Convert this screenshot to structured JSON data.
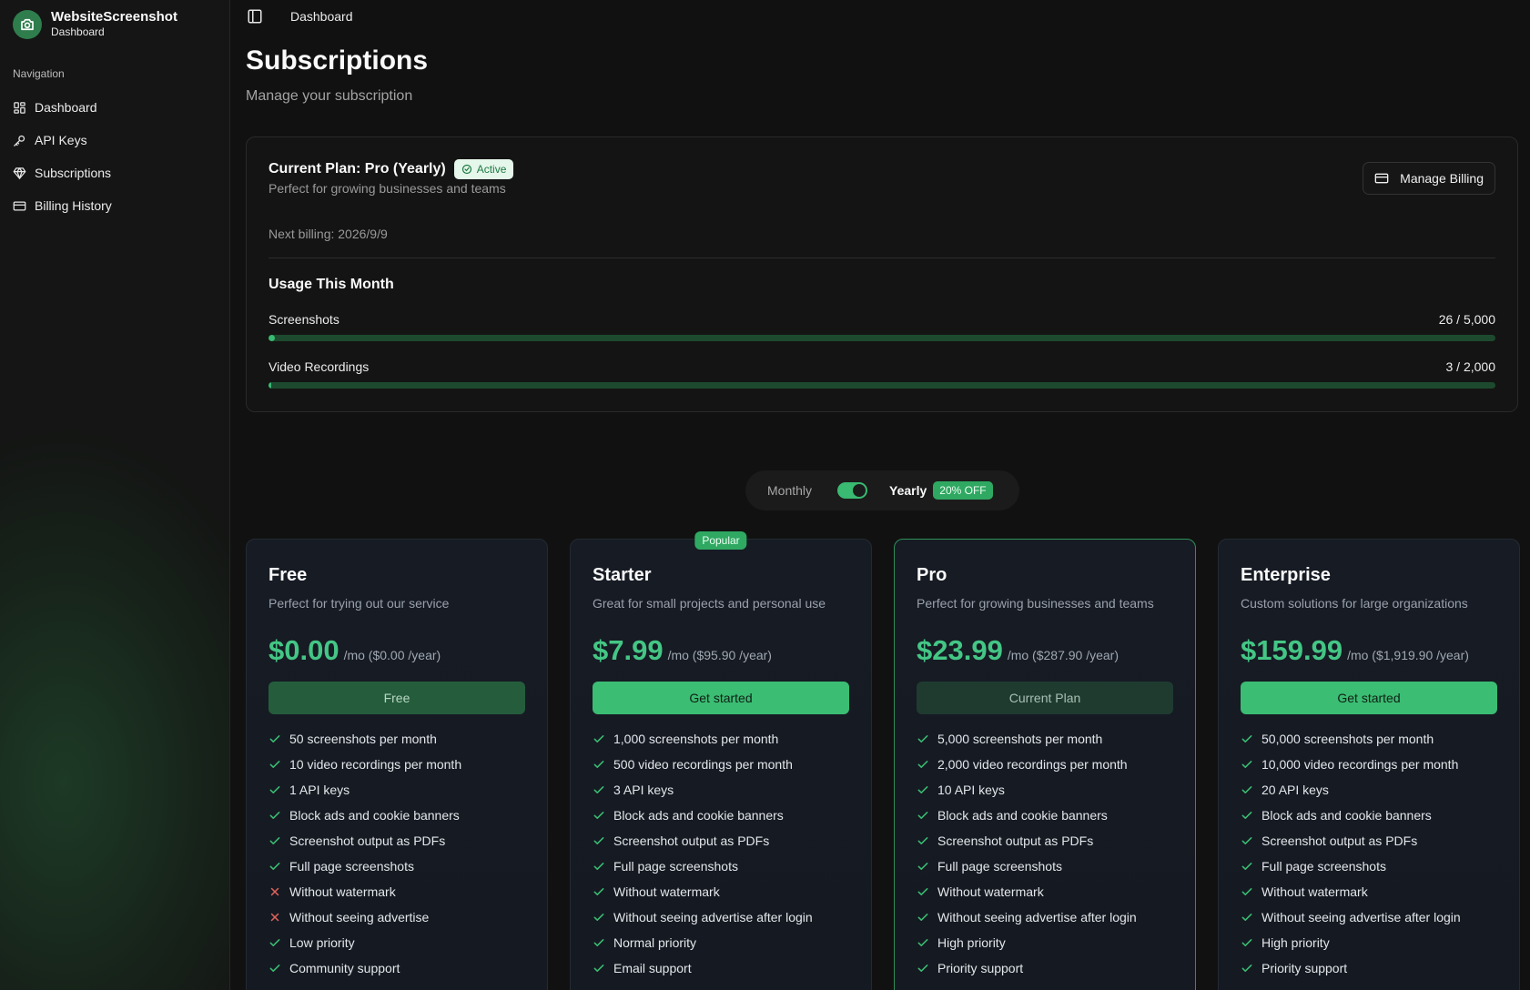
{
  "brand": {
    "title": "WebsiteScreenshot",
    "subtitle": "Dashboard"
  },
  "nav": {
    "heading": "Navigation",
    "items": [
      {
        "label": "Dashboard",
        "icon": "grid-icon"
      },
      {
        "label": "API Keys",
        "icon": "key-icon"
      },
      {
        "label": "Subscriptions",
        "icon": "gem-icon"
      },
      {
        "label": "Billing History",
        "icon": "credit-card-icon"
      }
    ]
  },
  "topbar": {
    "breadcrumb": "Dashboard"
  },
  "header": {
    "title": "Subscriptions",
    "subtitle": "Manage your subscription"
  },
  "current_plan": {
    "title": "Current Plan: Pro (Yearly)",
    "status": "Active",
    "description": "Perfect for growing businesses and teams",
    "manage_label": "Manage Billing",
    "next_billing": "Next billing: 2026/9/9",
    "usage_title": "Usage This Month",
    "usage": [
      {
        "label": "Screenshots",
        "count": "26 / 5,000",
        "used": 26,
        "limit": 5000
      },
      {
        "label": "Video Recordings",
        "count": "3 / 2,000",
        "used": 3,
        "limit": 2000
      }
    ]
  },
  "billing_toggle": {
    "monthly": "Monthly",
    "yearly": "Yearly",
    "discount": "20% OFF",
    "selected": "yearly"
  },
  "colors": {
    "accent": "#39b971",
    "price": "#44c685",
    "check": "#3bbd73",
    "cross": "#e0625a"
  },
  "plans": [
    {
      "name": "Free",
      "description": "Perfect for trying out our service",
      "price": "$0.00",
      "period": "/mo ($0.00 /year)",
      "button": "Free",
      "button_style": "free",
      "features": [
        {
          "text": "50 screenshots per month",
          "ok": true
        },
        {
          "text": "10 video recordings per month",
          "ok": true
        },
        {
          "text": "1 API keys",
          "ok": true
        },
        {
          "text": "Block ads and cookie banners",
          "ok": true
        },
        {
          "text": "Screenshot output as PDFs",
          "ok": true
        },
        {
          "text": "Full page screenshots",
          "ok": true
        },
        {
          "text": "Without watermark",
          "ok": false
        },
        {
          "text": "Without seeing advertise",
          "ok": false
        },
        {
          "text": "Low priority",
          "ok": true
        },
        {
          "text": "Community support",
          "ok": true
        }
      ]
    },
    {
      "name": "Starter",
      "description": "Great for small projects and personal use",
      "price": "$7.99",
      "period": "/mo ($95.90 /year)",
      "badge": "Popular",
      "button": "Get started",
      "button_style": "start",
      "features": [
        {
          "text": "1,000 screenshots per month",
          "ok": true
        },
        {
          "text": "500 video recordings per month",
          "ok": true
        },
        {
          "text": "3 API keys",
          "ok": true
        },
        {
          "text": "Block ads and cookie banners",
          "ok": true
        },
        {
          "text": "Screenshot output as PDFs",
          "ok": true
        },
        {
          "text": "Full page screenshots",
          "ok": true
        },
        {
          "text": "Without watermark",
          "ok": true
        },
        {
          "text": "Without seeing advertise after login",
          "ok": true
        },
        {
          "text": "Normal priority",
          "ok": true
        },
        {
          "text": "Email support",
          "ok": true
        }
      ]
    },
    {
      "name": "Pro",
      "description": "Perfect for growing businesses and teams",
      "price": "$23.99",
      "period": "/mo ($287.90 /year)",
      "button": "Current Plan",
      "button_style": "current",
      "highlight": true,
      "features": [
        {
          "text": "5,000 screenshots per month",
          "ok": true
        },
        {
          "text": "2,000 video recordings per month",
          "ok": true
        },
        {
          "text": "10 API keys",
          "ok": true
        },
        {
          "text": "Block ads and cookie banners",
          "ok": true
        },
        {
          "text": "Screenshot output as PDFs",
          "ok": true
        },
        {
          "text": "Full page screenshots",
          "ok": true
        },
        {
          "text": "Without watermark",
          "ok": true
        },
        {
          "text": "Without seeing advertise after login",
          "ok": true
        },
        {
          "text": "High priority",
          "ok": true
        },
        {
          "text": "Priority support",
          "ok": true
        }
      ]
    },
    {
      "name": "Enterprise",
      "description": "Custom solutions for large organizations",
      "price": "$159.99",
      "period": "/mo ($1,919.90 /year)",
      "button": "Get started",
      "button_style": "start",
      "features": [
        {
          "text": "50,000 screenshots per month",
          "ok": true
        },
        {
          "text": "10,000 video recordings per month",
          "ok": true
        },
        {
          "text": "20 API keys",
          "ok": true
        },
        {
          "text": "Block ads and cookie banners",
          "ok": true
        },
        {
          "text": "Screenshot output as PDFs",
          "ok": true
        },
        {
          "text": "Full page screenshots",
          "ok": true
        },
        {
          "text": "Without watermark",
          "ok": true
        },
        {
          "text": "Without seeing advertise after login",
          "ok": true
        },
        {
          "text": "High priority",
          "ok": true
        },
        {
          "text": "Priority support",
          "ok": true
        }
      ]
    }
  ]
}
